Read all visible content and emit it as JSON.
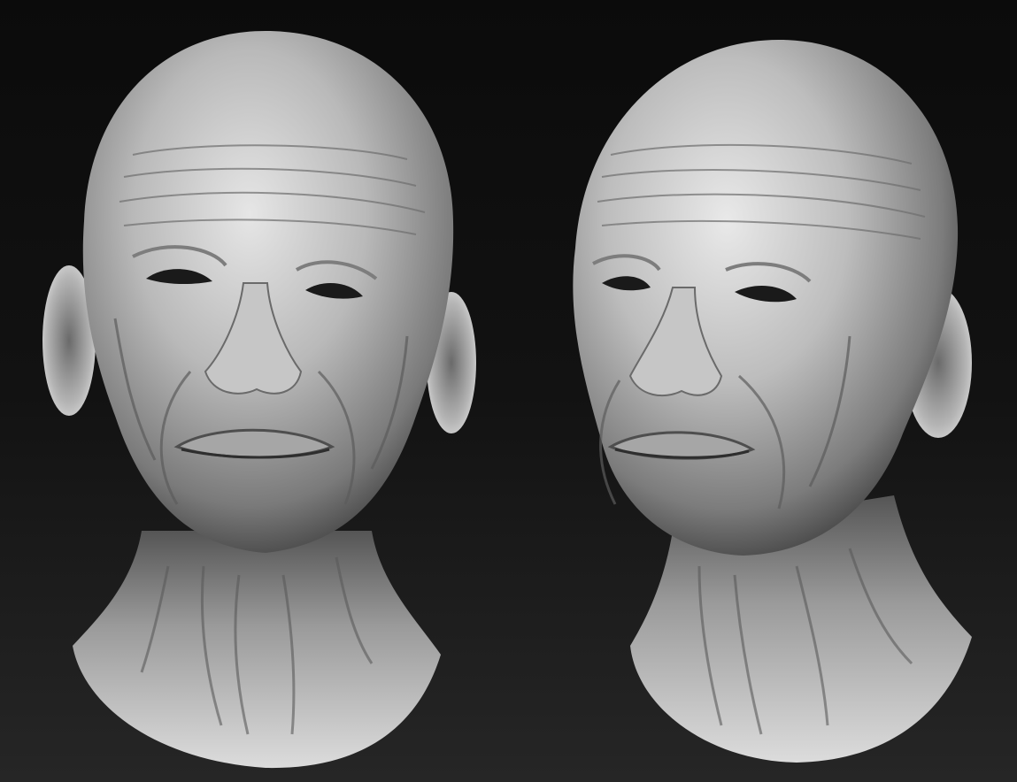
{
  "scene": {
    "background_top": "#0b0b0b",
    "background_bottom": "#262626",
    "material_color": "#b9b9b9",
    "subject": "clay-sculpt-head",
    "views": [
      {
        "id": "front-view"
      },
      {
        "id": "three-quarter-view"
      }
    ]
  }
}
